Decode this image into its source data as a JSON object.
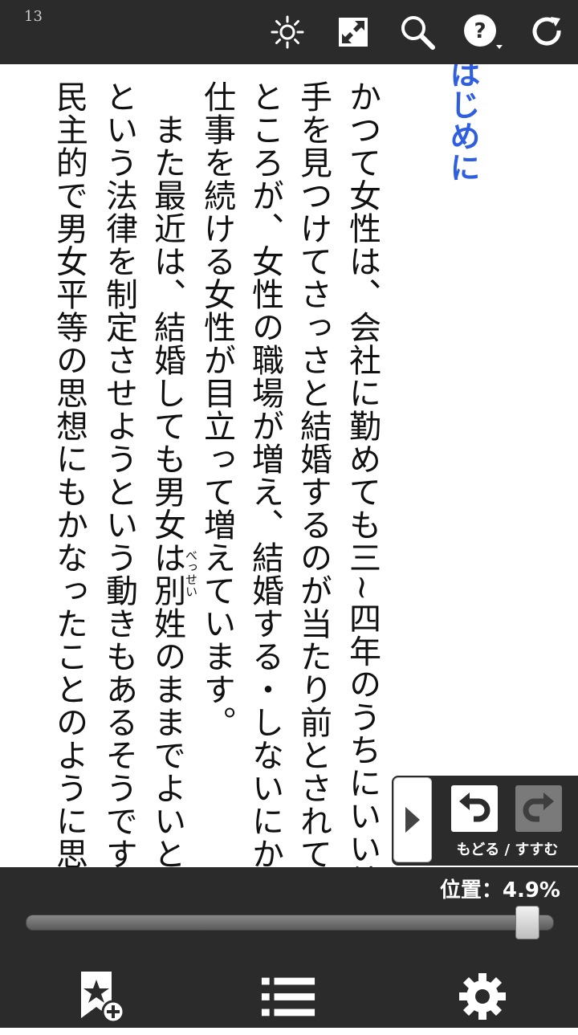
{
  "page_number": "13",
  "toolbar": {
    "icons": [
      "brightness-icon",
      "fit-screen-icon",
      "search-icon",
      "help-icon",
      "refresh-icon"
    ]
  },
  "content": {
    "heading": "はじめに",
    "columns": [
      "かつて女性は、会社に勤めても三~四年のうちにいい結婚相",
      "手を見つけてさっさと結婚するのが当たり前とされていました。",
      "ところが、女性の職場が増え、結婚する・しないにかかわらず",
      "仕事を続ける女性が目立って増えています。",
      "　また最近は、結婚しても男女は別姓のままでよいとすべきだ",
      "という法律を制定させようという動きもあるそうです。一見、",
      "民主的で男女平等の思想にもかなったことのように思えますが"
    ],
    "ruby": "べっせい"
  },
  "history_nav": {
    "label": "もどる / すすむ"
  },
  "progress": {
    "label": "位置：4.9%",
    "fraction": 0.951
  },
  "bottom": {
    "icons": [
      "add-bookmark-icon",
      "table-of-contents-icon",
      "settings-icon"
    ]
  }
}
